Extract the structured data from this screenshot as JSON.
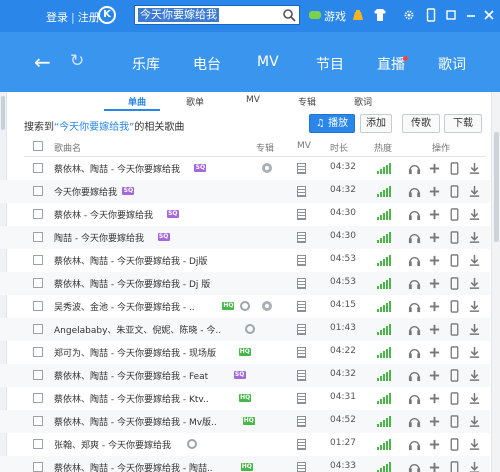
{
  "topbar": {
    "login": "登录",
    "register": "注册",
    "logo_letter": "K",
    "search_query": "今天你要嫁给我",
    "game": "游戏"
  },
  "nav": {
    "items": [
      "乐库",
      "电台",
      "MV",
      "节目",
      "直播",
      "歌词"
    ]
  },
  "tabs": [
    "单曲",
    "歌单",
    "MV",
    "专辑",
    "歌词"
  ],
  "result": {
    "prefix": "搜索到",
    "keyword": "“今天你要嫁给我”",
    "suffix": "的相关歌曲"
  },
  "buttons": {
    "play": "播放",
    "add": "添加",
    "upload": "传歌",
    "download": "下载"
  },
  "columns": {
    "name": "歌曲名",
    "album": "专辑",
    "mv": "MV",
    "duration": "时长",
    "heat": "热度",
    "action": "操作"
  },
  "rows": [
    {
      "name": "蔡依林、陶喆 - 今天你要嫁给我",
      "badge": "SQ",
      "album": true,
      "duration": "04:32"
    },
    {
      "name": "今天你要嫁给我",
      "badge": "SQ",
      "album": false,
      "duration": "04:32"
    },
    {
      "name": "蔡依林 - 今天你要嫁给我",
      "badge": "SQ",
      "album": false,
      "duration": "04:30"
    },
    {
      "name": "陶喆 - 今天你要嫁给我",
      "badge": "SQ",
      "album": false,
      "duration": "04:30"
    },
    {
      "name": "蔡依林、陶喆 - 今天你要嫁给我 - Dj版",
      "badge": "",
      "album": false,
      "duration": "04:53"
    },
    {
      "name": "蔡依林、陶喆 - 今天你要嫁给我 - Dj 版",
      "badge": "",
      "album": false,
      "duration": "04:53"
    },
    {
      "name": "吴秀波、金池 - 今天你要嫁给我 - ..",
      "badge": "HQ",
      "album": true,
      "disc": true,
      "duration": "04:15"
    },
    {
      "name": "Angelababy、朱亚文、倪妮、陈晓 - 今..",
      "badge": "",
      "album": false,
      "disc": true,
      "duration": "01:43"
    },
    {
      "name": "郑可为、陶喆 - 今天你要嫁给我 - 现场版",
      "badge": "HQ",
      "album": false,
      "duration": "04:22"
    },
    {
      "name": "蔡依林、陶喆 - 今天你要嫁给我 - Feat",
      "badge": "SQ",
      "album": false,
      "duration": "04:32"
    },
    {
      "name": "蔡依林、陶喆 - 今天你要嫁给我 - Ktv..",
      "badge": "HQ",
      "album": false,
      "duration": "04:31"
    },
    {
      "name": "蔡依林、陶喆 - 今天你要嫁给我 - Mv版..",
      "badge": "HQ",
      "album": false,
      "duration": "04:52"
    },
    {
      "name": "张翰、郑爽 - 今天你要嫁给我",
      "badge": "",
      "album": false,
      "disc": true,
      "duration": "01:27"
    },
    {
      "name": "蔡依林、陶喆 - 今天你要嫁给我 - 陶喆..",
      "badge": "HQ",
      "album": false,
      "duration": "04:33"
    }
  ],
  "colors": {
    "topbar": "#2a86e8",
    "nav": "#3a95ee",
    "accent": "#2a86e8",
    "sq_badge": "#a668d8",
    "hq_badge": "#46b84a",
    "heat": "#4ab64a"
  }
}
